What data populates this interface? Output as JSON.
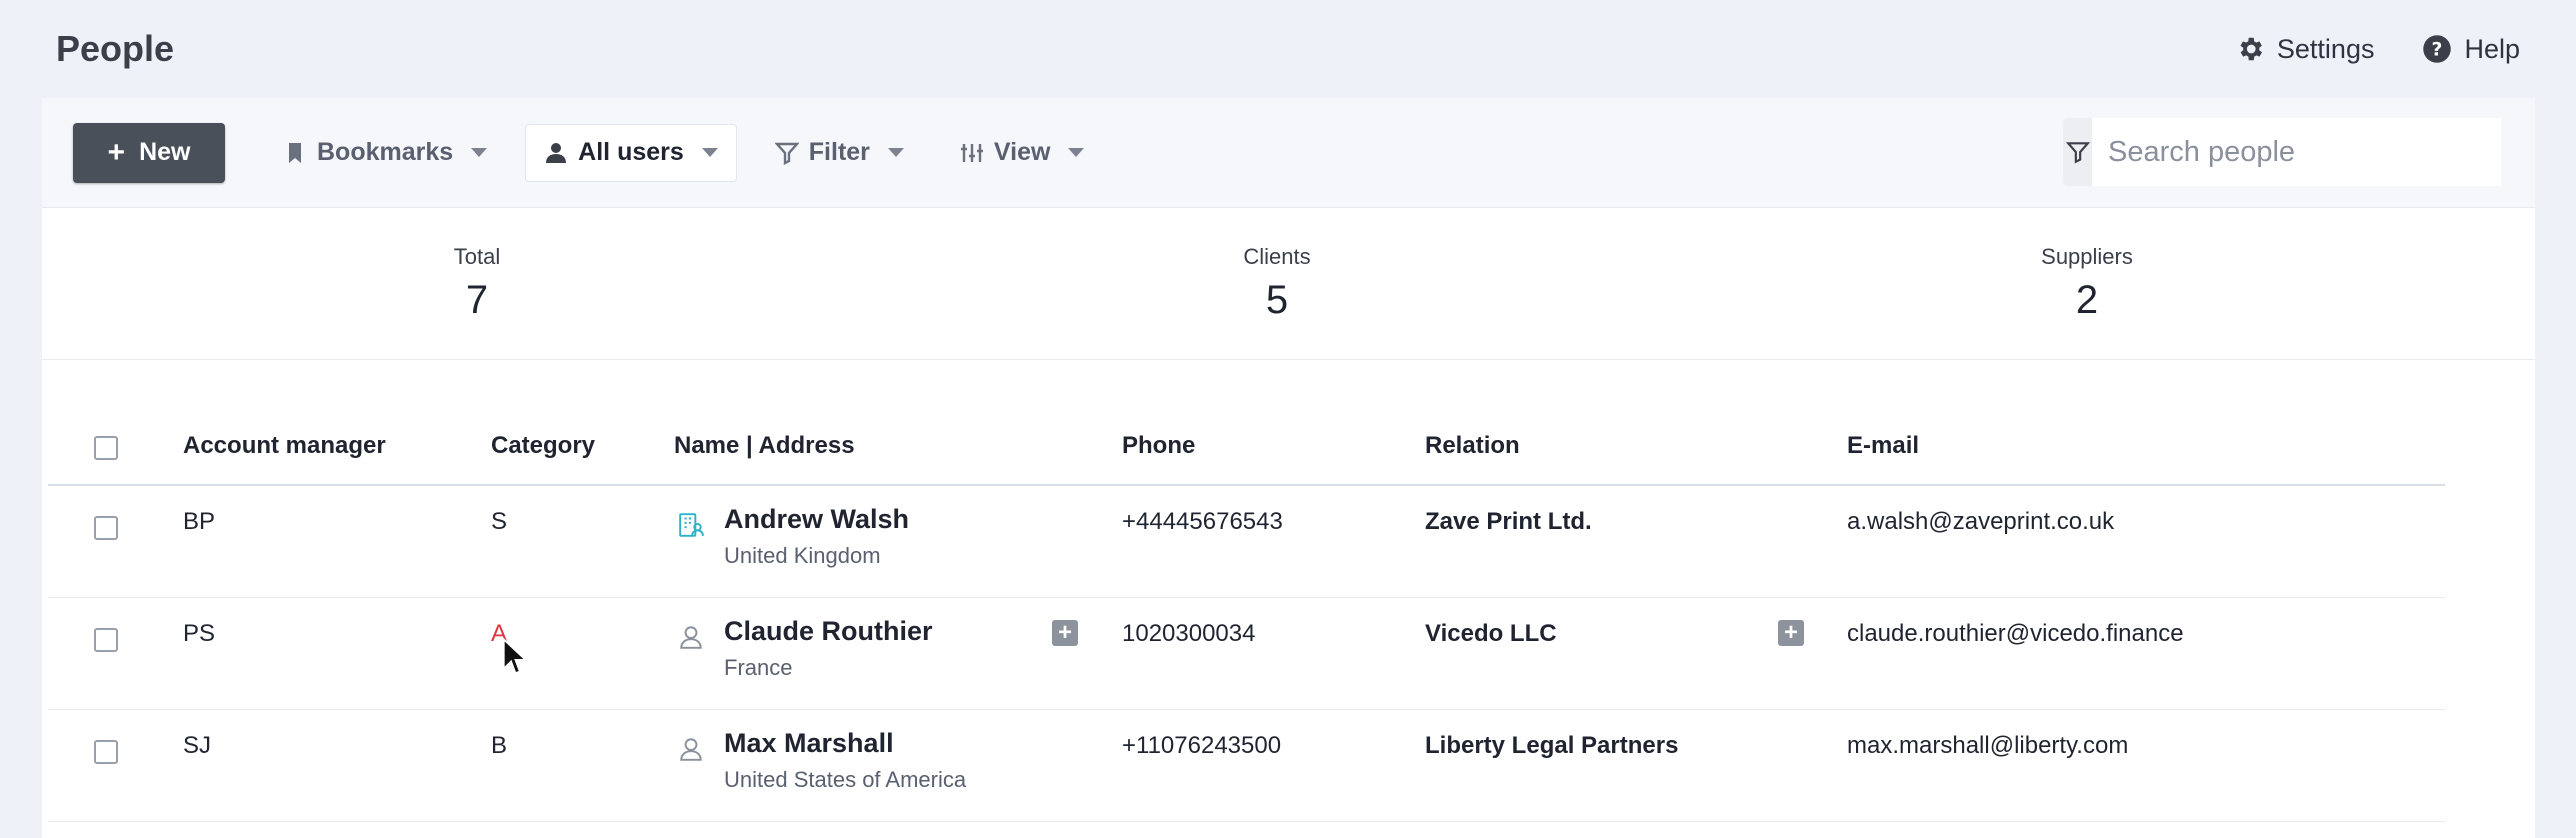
{
  "header": {
    "title": "People",
    "settings_label": "Settings",
    "help_label": "Help"
  },
  "toolbar": {
    "new_label": "New",
    "bookmarks_label": "Bookmarks",
    "users_label": "All users",
    "filter_label": "Filter",
    "view_label": "View",
    "search_placeholder": "Search people"
  },
  "stats": [
    {
      "label": "Total",
      "value": "7"
    },
    {
      "label": "Clients",
      "value": "5"
    },
    {
      "label": "Suppliers",
      "value": "2"
    }
  ],
  "table": {
    "columns": [
      "Account manager",
      "Category",
      "Name | Address",
      "Phone",
      "Relation",
      "E-mail"
    ],
    "rows": [
      {
        "manager": "BP",
        "category": "S",
        "name": "Andrew Walsh",
        "address": "United Kingdom",
        "phone": "+44445676543",
        "relation": "Zave Print Ltd.",
        "email": "a.walsh@zaveprint.co.uk",
        "icon": "company-contact-icon"
      },
      {
        "manager": "PS",
        "category": "A",
        "name": "Claude Routhier",
        "address": "France",
        "phone": "1020300034",
        "relation": "Vicedo LLC",
        "email": "claude.routhier@vicedo.finance",
        "icon": "person-icon"
      },
      {
        "manager": "SJ",
        "category": "B",
        "name": "Max Marshall",
        "address": "United States of America",
        "phone": "+11076243500",
        "relation": "Liberty Legal Partners",
        "email": "max.marshall@liberty.com",
        "icon": "person-icon"
      }
    ]
  },
  "colors": {
    "accent_red": "#e03540",
    "company_icon": "#2bb3c9"
  }
}
